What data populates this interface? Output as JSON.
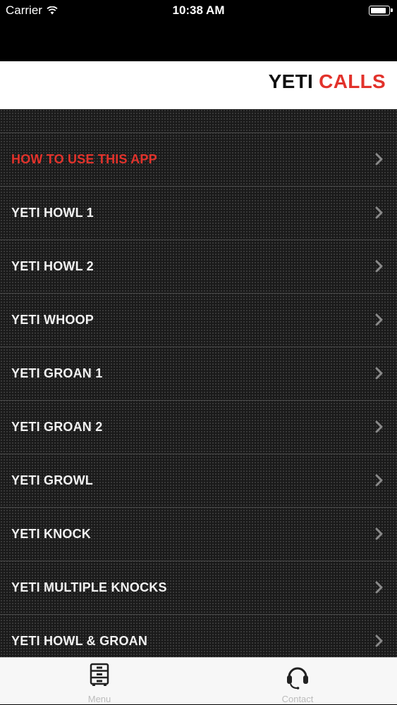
{
  "status_bar": {
    "carrier": "Carrier",
    "time": "10:38 AM",
    "wifi_icon": "wifi-icon",
    "battery_icon": "battery-icon",
    "battery_level": 0.9
  },
  "header": {
    "title_part1": "YETI",
    "title_part2": "CALLS",
    "accent_color": "#e2322b"
  },
  "menu": {
    "items": [
      {
        "label": "HOW TO USE THIS APP"
      },
      {
        "label": "YETI HOWL 1"
      },
      {
        "label": "YETI HOWL 2"
      },
      {
        "label": "YETI WHOOP"
      },
      {
        "label": "YETI GROAN 1"
      },
      {
        "label": "YETI GROAN 2"
      },
      {
        "label": "YETI GROWL"
      },
      {
        "label": "YETI KNOCK"
      },
      {
        "label": "YETI MULTIPLE KNOCKS"
      },
      {
        "label": "YETI HOWL & GROAN"
      }
    ],
    "chevron_icon": "chevron-right-icon"
  },
  "tabbar": {
    "tabs": [
      {
        "label": "Menu",
        "icon": "cabinet-icon"
      },
      {
        "label": "Contact",
        "icon": "headset-icon"
      }
    ]
  }
}
